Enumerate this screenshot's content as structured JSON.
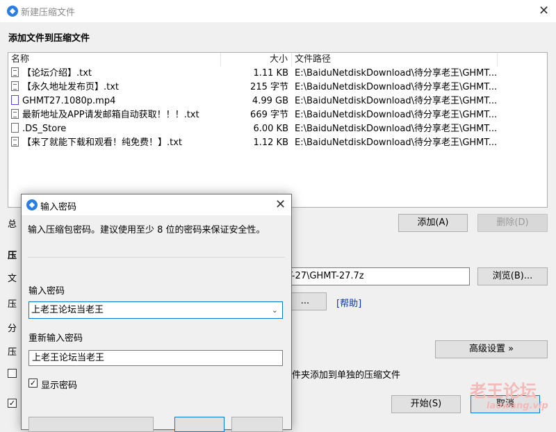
{
  "window": {
    "title": "新建压缩文件",
    "section_title": "添加文件到压缩文件"
  },
  "file_list": {
    "headers": {
      "name": "名称",
      "size": "大小",
      "path": "文件路径"
    },
    "rows": [
      {
        "name": "【论坛介绍】.txt",
        "size": "1.11 KB",
        "path": "E:\\BaiduNetdiskDownload\\待分享老王\\GHMT...",
        "icon": "text-file-icon"
      },
      {
        "name": "【永久地址发布页】.txt",
        "size": "215 字节",
        "path": "E:\\BaiduNetdiskDownload\\待分享老王\\GHMT...",
        "icon": "text-file-icon"
      },
      {
        "name": "GHMT27.1080p.mp4",
        "size": "4.99 GB",
        "path": "E:\\BaiduNetdiskDownload\\待分享老王\\GHMT...",
        "icon": "media-file-icon"
      },
      {
        "name": "最新地址及APP请发邮箱自动获取！！！.txt",
        "size": "669 字节",
        "path": "E:\\BaiduNetdiskDownload\\待分享老王\\GHMT...",
        "icon": "text-file-icon"
      },
      {
        "name": ".DS_Store",
        "size": "6.00 KB",
        "path": "E:\\BaiduNetdiskDownload\\待分享老王\\GHMT...",
        "icon": "blank-file-icon"
      },
      {
        "name": "【来了就能下载和观看！纯免费！】.txt",
        "size": "1.12 KB",
        "path": "E:\\BaiduNetdiskDownload\\待分享老王\\GHMT...",
        "icon": "text-file-icon"
      }
    ]
  },
  "partial_labels": {
    "total": "总",
    "compress_section": "压",
    "file_label": "文",
    "compress_label": "压",
    "split_label": "分",
    "compress_label2": "压"
  },
  "buttons": {
    "add": "添加(A)",
    "delete": "删除(D)",
    "browse": "浏览(B)...",
    "ellipsis": "...",
    "advanced": "高级设置 »",
    "start": "开始(S)",
    "cancel": "取消"
  },
  "output_path_visible": "T-27\\GHMT-27.7z",
  "help_link": "[帮助]",
  "separate_checkbox_label_visible": "件夹添加到单独的压缩文件",
  "dialog": {
    "title": "输入密码",
    "description": "输入压缩包密码。建议使用至少 8 位的密码来保证安全性。",
    "password_label": "输入密码",
    "password_value": "上老王论坛当老王",
    "confirm_label": "重新输入密码",
    "confirm_value": "上老王论坛当老王",
    "show_password_label": "显示密码",
    "show_password_checked": true
  },
  "watermark": {
    "text": "老王论坛",
    "url": "laowang.vip"
  }
}
